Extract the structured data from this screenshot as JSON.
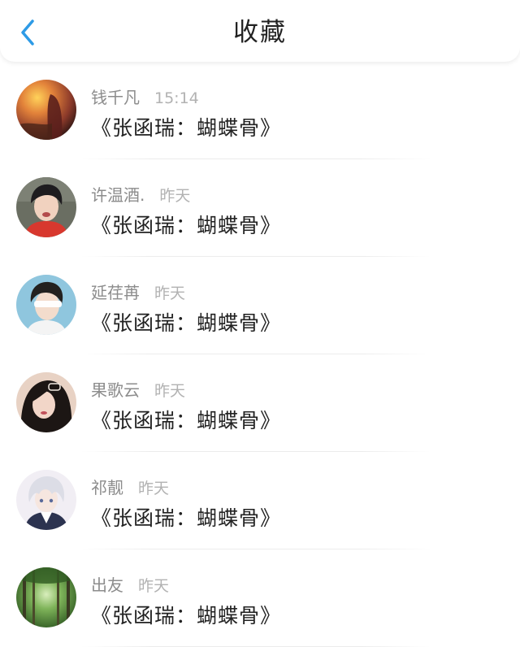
{
  "header": {
    "title": "收藏",
    "back_icon": "chevron-left-icon",
    "accent_color": "#2e9be6"
  },
  "items": [
    {
      "name": "钱千凡",
      "time": "15:14",
      "message": "《张函瑞：蝴蝶骨》",
      "avatar_icon": "sunset-avatar"
    },
    {
      "name": "许温酒.",
      "time": "昨天",
      "message": "《张函瑞：蝴蝶骨》",
      "avatar_icon": "boy-red-shirt-avatar"
    },
    {
      "name": "延荏苒",
      "time": "昨天",
      "message": "《张函瑞：蝴蝶骨》",
      "avatar_icon": "boy-blindfold-avatar"
    },
    {
      "name": "果歌云",
      "time": "昨天",
      "message": "《张函瑞：蝴蝶骨》",
      "avatar_icon": "girl-dark-hair-avatar"
    },
    {
      "name": "祁靓",
      "time": "昨天",
      "message": "《张函瑞：蝴蝶骨》",
      "avatar_icon": "anime-white-hair-avatar"
    },
    {
      "name": "出友",
      "time": "昨天",
      "message": "《张函瑞：蝴蝶骨》",
      "avatar_icon": "forest-avatar"
    }
  ]
}
